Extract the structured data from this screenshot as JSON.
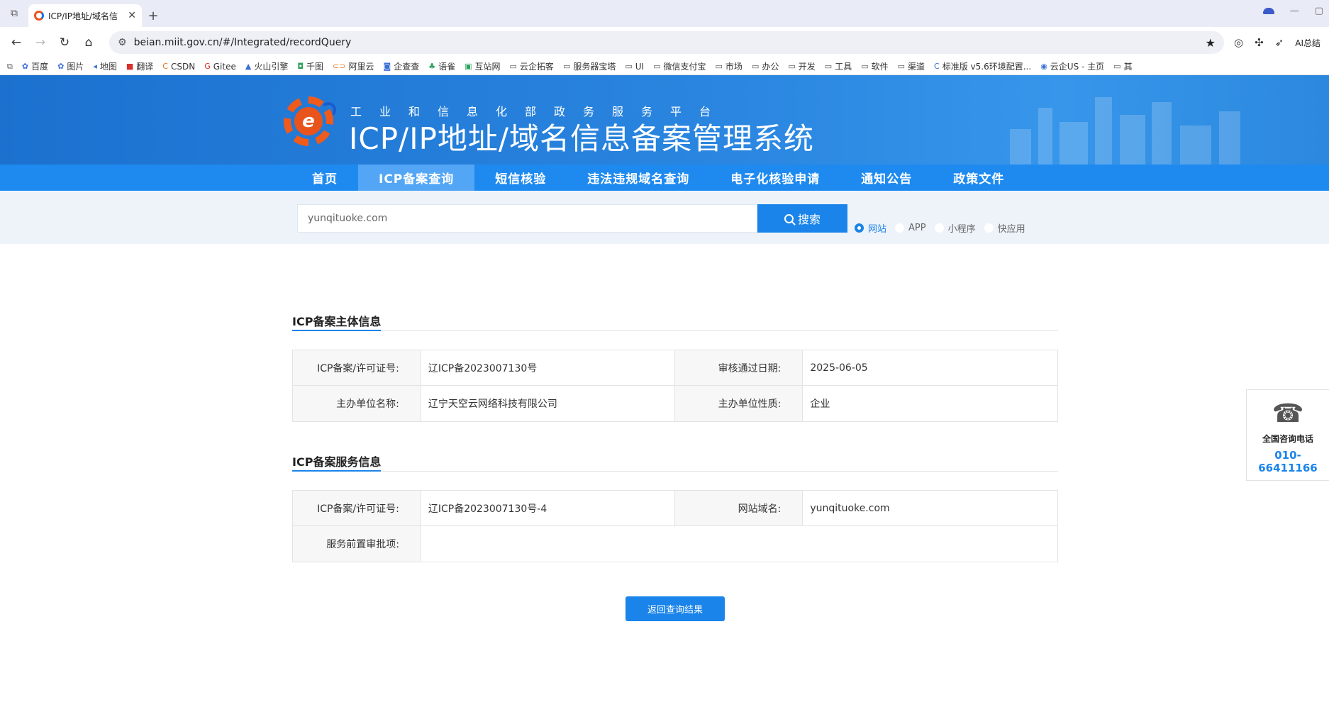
{
  "browser": {
    "tab_title": "ICP/IP地址/域名信",
    "url": "beian.miit.gov.cn/#/Integrated/recordQuery",
    "ai_label": "AI总结",
    "bookmarks": [
      "百度",
      "图片",
      "地图",
      "翻译",
      "CSDN",
      "Gitee",
      "火山引擎",
      "千图",
      "阿里云",
      "企查查",
      "语雀",
      "互站网",
      "云企拓客",
      "服务器宝塔",
      "UI",
      "微信支付宝",
      "市场",
      "办公",
      "开发",
      "工具",
      "软件",
      "渠道",
      "标准版 v5.6环境配置...",
      "云企US - 主页",
      "其"
    ]
  },
  "header": {
    "subtitle": "工业和信息化部政务服务平台",
    "title": "ICP/IP地址/域名信息备案管理系统"
  },
  "nav": {
    "items": [
      "首页",
      "ICP备案查询",
      "短信核验",
      "违法违规域名查询",
      "电子化核验申请",
      "通知公告",
      "政策文件"
    ],
    "active": "ICP备案查询"
  },
  "search": {
    "value": "yunqituoke.com",
    "button": "搜索",
    "types": [
      "网站",
      "APP",
      "小程序",
      "快应用"
    ],
    "selected_type": "网站"
  },
  "subject": {
    "title": "ICP备案主体信息",
    "license_label": "ICP备案/许可证号:",
    "license_value": "辽ICP备2023007130号",
    "date_label": "审核通过日期:",
    "date_value": "2025-06-05",
    "org_label": "主办单位名称:",
    "org_value": "辽宁天空云网络科技有限公司",
    "nature_label": "主办单位性质:",
    "nature_value": "企业"
  },
  "service": {
    "title": "ICP备案服务信息",
    "license_label": "ICP备案/许可证号:",
    "license_value": "辽ICP备2023007130号-4",
    "domain_label": "网站域名:",
    "domain_value": "yunqituoke.com",
    "approval_label": "服务前置审批项:",
    "approval_value": ""
  },
  "back_button": "返回查询结果",
  "consult": {
    "label": "全国咨询电话",
    "phone": "010-66411166"
  }
}
